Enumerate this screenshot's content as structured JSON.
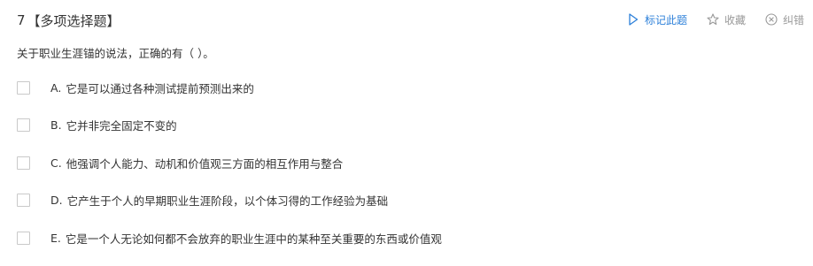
{
  "question": {
    "number": "7",
    "type": "【多项选择题】",
    "stem": "关于职业生涯锚的说法，正确的有（    ）。"
  },
  "tools": {
    "mark_label": "标记此题",
    "favorite_label": "收藏",
    "report_label": "纠错",
    "mark_color": "#2b7fd9"
  },
  "options": [
    {
      "letter": "A.",
      "text": "它是可以通过各种测试提前预测出来的"
    },
    {
      "letter": "B.",
      "text": "它并非完全固定不变的"
    },
    {
      "letter": "C.",
      "text": "他强调个人能力、动机和价值观三方面的相互作用与整合"
    },
    {
      "letter": "D.",
      "text": "它产生于个人的早期职业生涯阶段，以个体习得的工作经验为基础"
    },
    {
      "letter": "E.",
      "text": "它是一个人无论如何都不会放弃的职业生涯中的某种至关重要的东西或价值观"
    }
  ]
}
